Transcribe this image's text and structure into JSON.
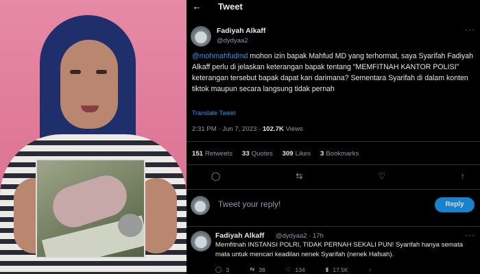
{
  "header": {
    "back_icon": "arrow-left-icon",
    "title": "Tweet"
  },
  "tweet": {
    "author_name": "Fadiyah Alkaff",
    "author_handle": "@dydyaa2",
    "mention": "@mohmahfudmd",
    "text_rest": " mohon izin bapak Mahfud MD yang terhormat, saya Syarifah Fadiyah Alkaff  perlu di jelaskan keterangan bapak tentang \"MEMFITNAH KANTOR POLISI\" keterangan tersebut bapak dapat kan darimana? Sementara Syarifah di dalam konten tiktok maupun secara langsung tidak pernah",
    "translate": "Translate Tweet",
    "time": "2:31 PM · Jun 7, 2023 · ",
    "views_count": "102.7K",
    "views_label": " Views",
    "stats": [
      {
        "count": "151",
        "label": "Retweets"
      },
      {
        "count": "33",
        "label": "Quotes"
      },
      {
        "count": "309",
        "label": "Likes"
      },
      {
        "count": "3",
        "label": "Bookmarks"
      }
    ],
    "action_icons": [
      "reply-icon",
      "retweet-icon",
      "like-icon",
      "share-icon"
    ]
  },
  "reply_box": {
    "placeholder": "Tweet your reply!",
    "button": "Reply"
  },
  "reply": {
    "author_name": "Fadiyah Alkaff",
    "author_handle": "@dydyaa2 · 17h",
    "text": "Memfitnah INSTANSI POLRI, TIDAK PERNAH SEKALI PUN! Syarifah hanya semata mata untuk mencari keadilan  nenek Syarifah (nenek Hafsah).",
    "actions": [
      {
        "icon": "reply-icon",
        "count": "3"
      },
      {
        "icon": "retweet-icon",
        "count": "38"
      },
      {
        "icon": "like-icon",
        "count": "134"
      },
      {
        "icon": "views-icon",
        "count": "17.5K"
      },
      {
        "icon": "share-icon",
        "count": ""
      }
    ]
  },
  "colors": {
    "accent": "#1d9bf0",
    "background": "#000000",
    "muted": "#8b98a5"
  }
}
